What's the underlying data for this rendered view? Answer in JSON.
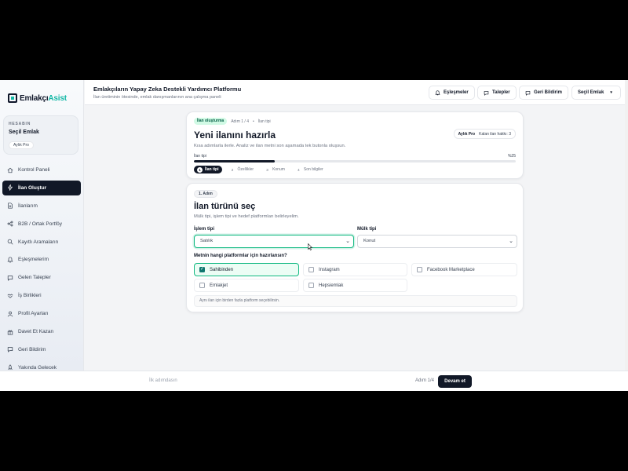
{
  "logo": {
    "text_main": "Emlakçı",
    "text_accent": "Asist"
  },
  "account": {
    "section_label": "HESABIN",
    "name": "Seçil Emlak",
    "plan": "Aylık Pro"
  },
  "sidebar": {
    "items": [
      {
        "label": "Kontrol Paneli",
        "icon": "home-icon",
        "active": false
      },
      {
        "label": "İlan Oluştur",
        "icon": "bolt-icon",
        "active": true
      },
      {
        "label": "İlanlarım",
        "icon": "document-icon",
        "active": false
      },
      {
        "label": "B2B / Ortak Portföy",
        "icon": "share-icon",
        "active": false
      },
      {
        "label": "Kayıtlı Aramaların",
        "icon": "search-icon",
        "active": false
      },
      {
        "label": "Eşleşmelerim",
        "icon": "bell-icon",
        "active": false
      },
      {
        "label": "Gelen Talepler",
        "icon": "chat-icon",
        "active": false
      },
      {
        "label": "İş Birlikleri",
        "icon": "handshake-icon",
        "active": false
      },
      {
        "label": "Profil Ayarları",
        "icon": "user-icon",
        "active": false
      },
      {
        "label": "Davet Et Kazan",
        "icon": "gift-icon",
        "active": false
      },
      {
        "label": "Geri Bildirim",
        "icon": "message-icon",
        "active": false
      },
      {
        "label": "Yakında Gelecek",
        "icon": "rocket-icon",
        "active": false
      }
    ]
  },
  "topbar": {
    "title": "Emlakçıların Yapay Zeka Destekli Yardımcı Platformu",
    "subtitle": "İlan üretiminin ötesinde, emlak danışmanlarının ana çalışma paneli",
    "buttons": {
      "matches": "Eşleşmeler",
      "requests": "Talepler",
      "feedback": "Geri Bildirim",
      "account": "Seçil Emlak"
    }
  },
  "header_card": {
    "breadcrumb_pill": "İlan oluşturma",
    "breadcrumb_step": "Adım 1 / 4",
    "breadcrumb_current": "İlan tipi",
    "title": "Yeni ilanını hazırla",
    "description": "Kısa adımlarla ilerle. Analiz ve ilan metni son aşamada tek butonla oluşsun.",
    "plan_name": "Aylık Pro",
    "remaining_label": "Kalan ilan hakkı:",
    "remaining_value": "3",
    "progress_label": "İlan tipi",
    "progress_pct_label": "%25",
    "progress_value": 25,
    "steps": [
      {
        "num": "1",
        "label": "İlan tipi",
        "active": true
      },
      {
        "num": "2",
        "label": "Özellikler",
        "active": false
      },
      {
        "num": "3",
        "label": "Konum",
        "active": false
      },
      {
        "num": "4",
        "label": "Son bilgiler",
        "active": false
      }
    ]
  },
  "form_card": {
    "step_label": "1. Adım",
    "title": "İlan türünü seç",
    "description": "Mülk tipi, işlem tipi ve hedef platformları belirleyelim.",
    "transaction_label": "İşlem tipi",
    "transaction_value": "Satılık",
    "property_label": "Mülk tipi",
    "property_value": "Konut",
    "platforms_label": "Metnin hangi platformlar için hazırlansın?",
    "platforms": [
      {
        "label": "Sahibinden",
        "checked": true
      },
      {
        "label": "Instagram",
        "checked": false
      },
      {
        "label": "Facebook Marketplace",
        "checked": false
      },
      {
        "label": "Emlakjet",
        "checked": false
      },
      {
        "label": "Hepsiemlak",
        "checked": false
      }
    ],
    "hint": "Aynı ilan için birden fazla platform seçebilirsin."
  },
  "footer": {
    "left": "İlk adımdasın",
    "step": "Adım 1/4",
    "next": "Devam et"
  },
  "colors": {
    "accent": "#14b8a6",
    "success": "#10b981",
    "dark": "#111827"
  }
}
